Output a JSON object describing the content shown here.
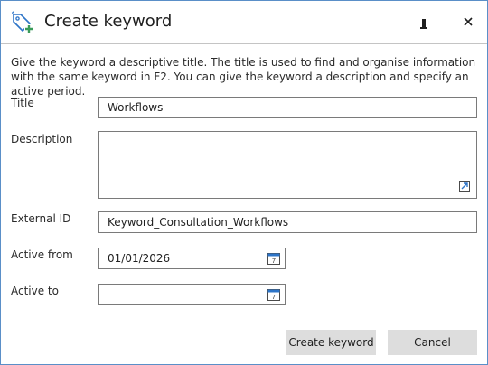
{
  "window": {
    "title": "Create keyword",
    "icon": "tag-add-icon",
    "controls": {
      "minimize": "minimize-icon",
      "close": "close-icon"
    }
  },
  "intro": "Give the keyword a descriptive title. The title is used to find and organise information with the same keyword in F2. You can give the keyword a description and specify an active period.",
  "form": {
    "title": {
      "label": "Title",
      "value": "Workflows"
    },
    "description": {
      "label": "Description",
      "value": ""
    },
    "external_id": {
      "label": "External ID",
      "value": "Keyword_Consultation_Workflows"
    },
    "active_from": {
      "label": "Active from",
      "value": "01/01/2026",
      "icon": "calendar-icon"
    },
    "active_to": {
      "label": "Active to",
      "value": "",
      "icon": "calendar-icon"
    }
  },
  "buttons": {
    "create": "Create keyword",
    "cancel": "Cancel"
  },
  "colors": {
    "accent": "#2e75c8",
    "border": "#7a7a7a",
    "button_bg": "#dddddd",
    "window_border": "#5a8fc8"
  }
}
